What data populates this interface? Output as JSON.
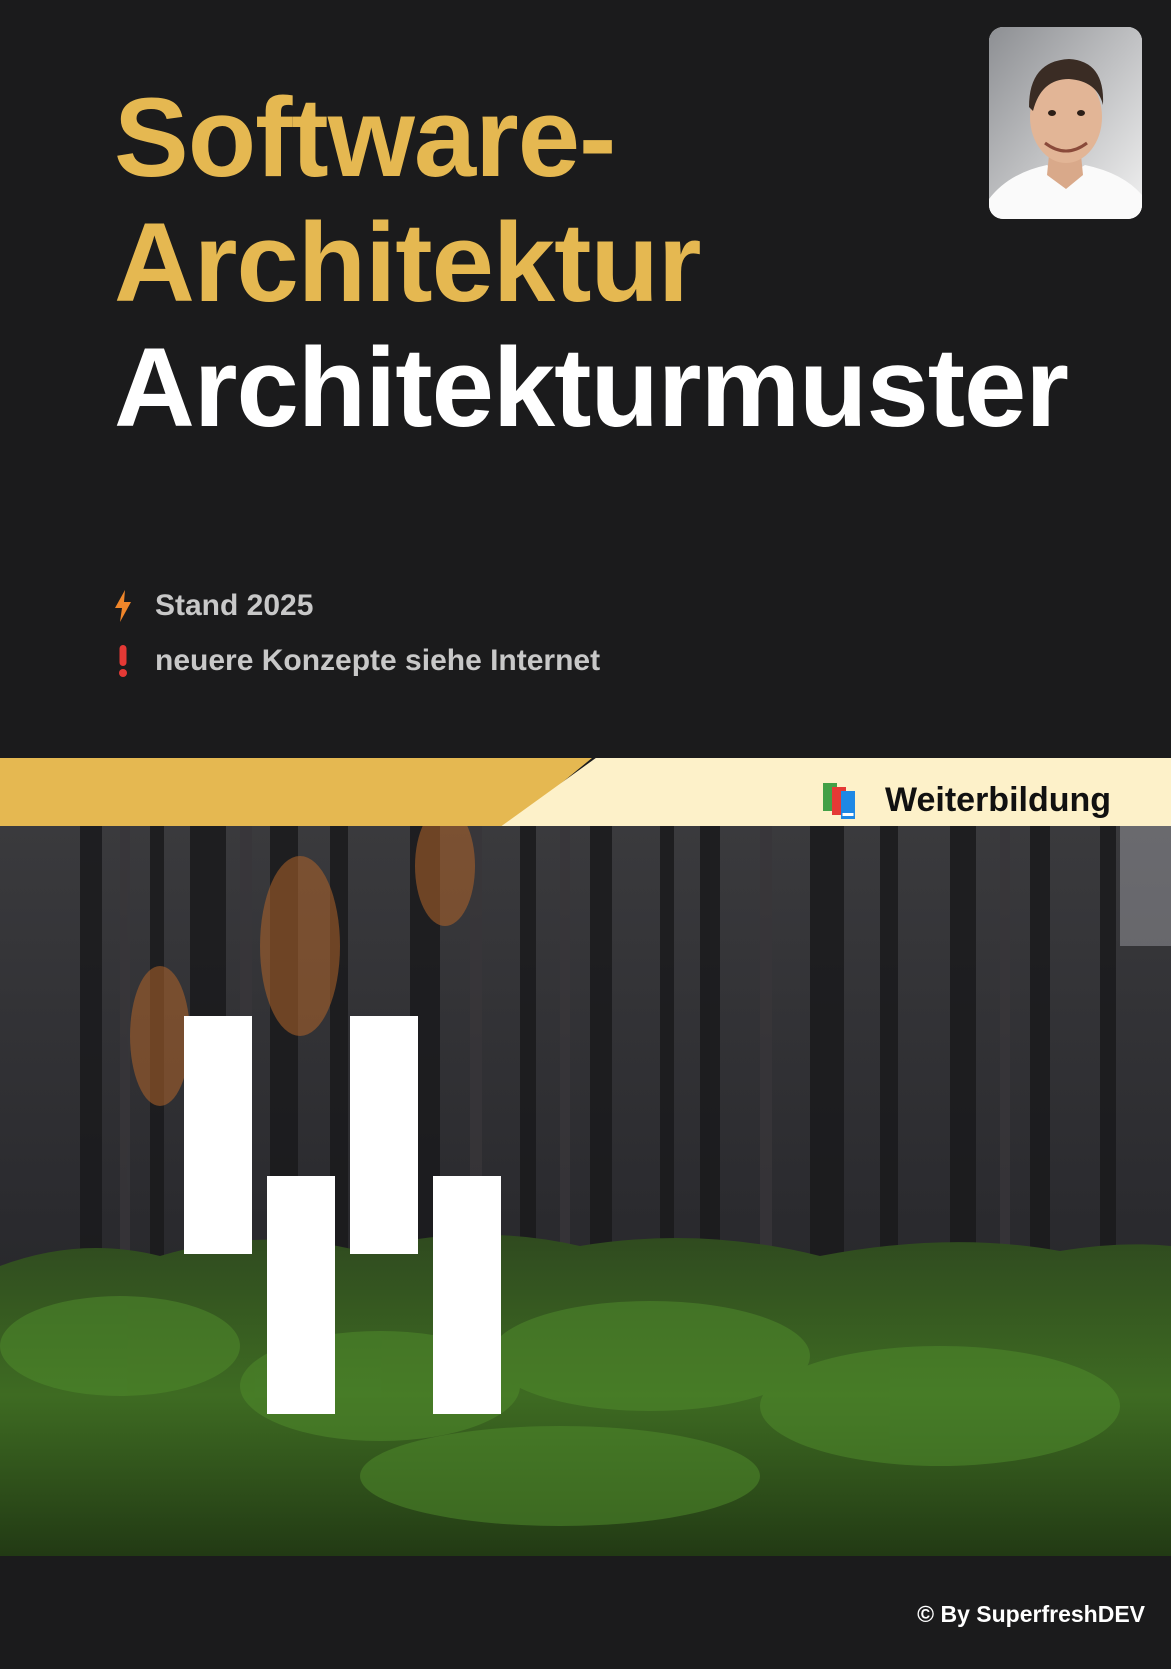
{
  "cover": {
    "title_line1": "Software-",
    "title_line2": "Architektur",
    "subtitle": "Architekturmuster"
  },
  "notes": [
    {
      "icon": "lightning-icon",
      "text": "Stand 2025",
      "color": "#f0862a"
    },
    {
      "icon": "exclamation-icon",
      "text": "neuere Konzepte siehe Internet",
      "color": "#e53935"
    }
  ],
  "badge": {
    "icon": "books-icon",
    "label": "Weiterbildung"
  },
  "footer": {
    "copyright": "© By SuperfreshDEV"
  },
  "colors": {
    "background": "#1b1b1c",
    "accent_gold": "#e5b851",
    "cream": "#fdf1c9",
    "white": "#ffffff"
  }
}
